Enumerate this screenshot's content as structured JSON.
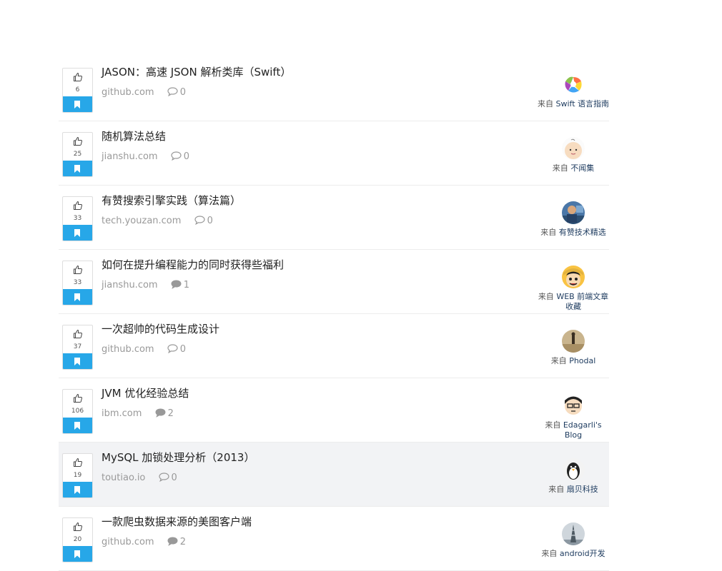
{
  "feed": {
    "from_label": "来自",
    "items": [
      {
        "title": "JASON：高速 JSON 解析类库（Swift）",
        "domain": "github.com",
        "votes": "6",
        "comments": "0",
        "channel": "Swift 语言指南",
        "avatar": "swift-logo-avatar"
      },
      {
        "title": "随机算法总结",
        "domain": "jianshu.com",
        "votes": "25",
        "comments": "0",
        "channel": "不闻集",
        "avatar": "baby-avatar"
      },
      {
        "title": "有赞搜索引擎实践（算法篇）",
        "domain": "tech.youzan.com",
        "votes": "33",
        "comments": "0",
        "channel": "有赞技术精选",
        "avatar": "photo-avatar"
      },
      {
        "title": "如何在提升编程能力的同时获得些福利",
        "domain": "jianshu.com",
        "votes": "33",
        "comments": "1",
        "channel": "WEB 前端文章收藏",
        "avatar": "luffy-avatar"
      },
      {
        "title": "一次超帅的代码生成设计",
        "domain": "github.com",
        "votes": "37",
        "comments": "0",
        "channel": "Phodal",
        "avatar": "silhouette-avatar"
      },
      {
        "title": "JVM 优化经验总结",
        "domain": "ibm.com",
        "votes": "106",
        "comments": "2",
        "channel": "Edagarli's Blog",
        "avatar": "cartoon-glasses-avatar"
      },
      {
        "title": "MySQL 加锁处理分析（2013）",
        "domain": "toutiao.io",
        "votes": "19",
        "comments": "0",
        "channel": "扇贝科技",
        "avatar": "penguin-avatar"
      },
      {
        "title": "一款爬虫数据来源的美图客户端",
        "domain": "github.com",
        "votes": "20",
        "comments": "2",
        "channel": "android开发",
        "avatar": "tower-avatar"
      }
    ]
  },
  "colors": {
    "accent": "#27a7e8",
    "title": "#222222",
    "meta": "#999999",
    "highlight_row": "#f2f3f5"
  }
}
